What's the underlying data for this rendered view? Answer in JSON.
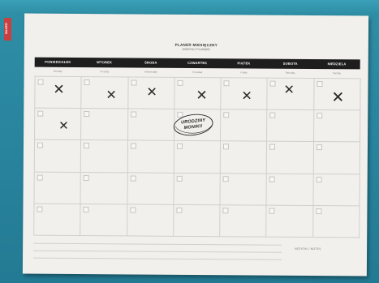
{
  "side_tag": {
    "label": "SILVER"
  },
  "planner": {
    "title": "PLANER MIESIĘCZNY",
    "subtitle": "MONTHLY PLANNER",
    "days": [
      "PONIEDZIAŁEK",
      "WTOREK",
      "ŚRODA",
      "CZWARTEK",
      "PIĄTEK",
      "SOBOTA",
      "NIEDZIELA"
    ],
    "day_sublabels": [
      "Monday",
      "Tuesday",
      "Wednesday",
      "Thursday",
      "Friday",
      "Saturday",
      "Sunday"
    ],
    "marks": [
      "✕",
      "✕",
      "✕",
      "✕",
      "✕",
      "✕",
      "✕",
      "✕"
    ],
    "stamp_line1": "URODZINY",
    "stamp_line2": "MONIKI!",
    "notes_label": "NOTATKI / NOTES"
  }
}
